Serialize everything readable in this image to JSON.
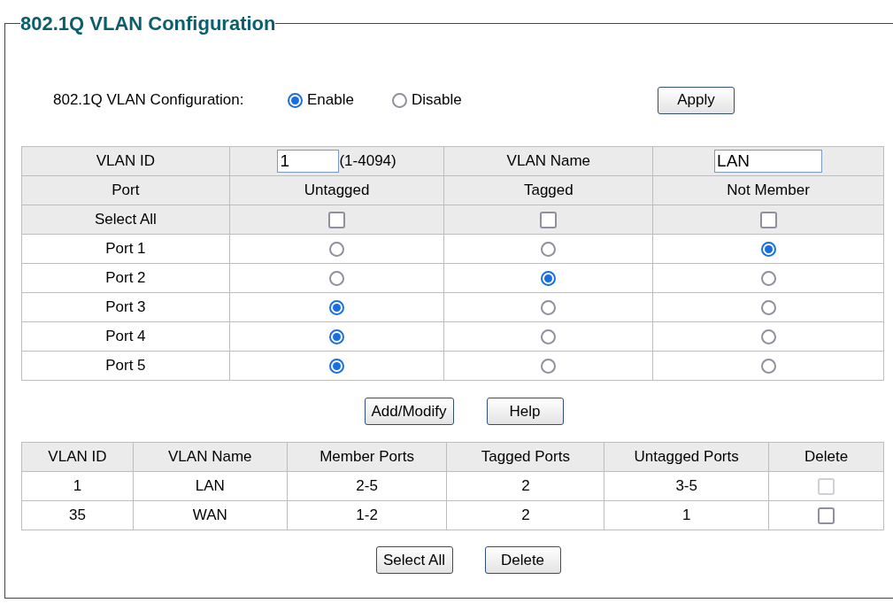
{
  "title": "802.1Q VLAN Configuration",
  "mode": {
    "label": "802.1Q VLAN Configuration:",
    "options": [
      {
        "label": "Enable",
        "selected": true
      },
      {
        "label": "Disable",
        "selected": false
      }
    ],
    "apply": "Apply"
  },
  "form": {
    "vlan_id_label": "VLAN ID",
    "vlan_id": "1",
    "vlan_id_range": "(1-4094)",
    "vlan_name_label": "VLAN Name",
    "vlan_name": "LAN",
    "columns": [
      "Port",
      "Untagged",
      "Tagged",
      "Not Member"
    ],
    "select_all": {
      "label": "Select All",
      "boxes": [
        {
          "checked": false
        },
        {
          "checked": false
        },
        {
          "checked": false
        }
      ]
    },
    "ports": [
      {
        "name": "Port 1",
        "options": [
          {
            "selected": false
          },
          {
            "selected": false
          },
          {
            "selected": true
          }
        ]
      },
      {
        "name": "Port 2",
        "options": [
          {
            "selected": false
          },
          {
            "selected": true
          },
          {
            "selected": false
          }
        ]
      },
      {
        "name": "Port 3",
        "options": [
          {
            "selected": true
          },
          {
            "selected": false
          },
          {
            "selected": false
          }
        ]
      },
      {
        "name": "Port 4",
        "options": [
          {
            "selected": true
          },
          {
            "selected": false
          },
          {
            "selected": false
          }
        ]
      },
      {
        "name": "Port 5",
        "options": [
          {
            "selected": true
          },
          {
            "selected": false
          },
          {
            "selected": false
          }
        ]
      }
    ],
    "buttons": [
      "Add/Modify",
      "Help"
    ]
  },
  "table": {
    "columns": [
      "VLAN ID",
      "VLAN Name",
      "Member Ports",
      "Tagged Ports",
      "Untagged Ports",
      "Delete"
    ],
    "rows": [
      {
        "cells": [
          "1",
          "LAN",
          "2-5",
          "2",
          "3-5"
        ],
        "delete": {
          "checked": false,
          "disabled": true
        }
      },
      {
        "cells": [
          "35",
          "WAN",
          "1-2",
          "2",
          "1"
        ],
        "delete": {
          "checked": false,
          "disabled": false
        }
      }
    ]
  },
  "buttons": [
    "Select All",
    "Delete"
  ]
}
